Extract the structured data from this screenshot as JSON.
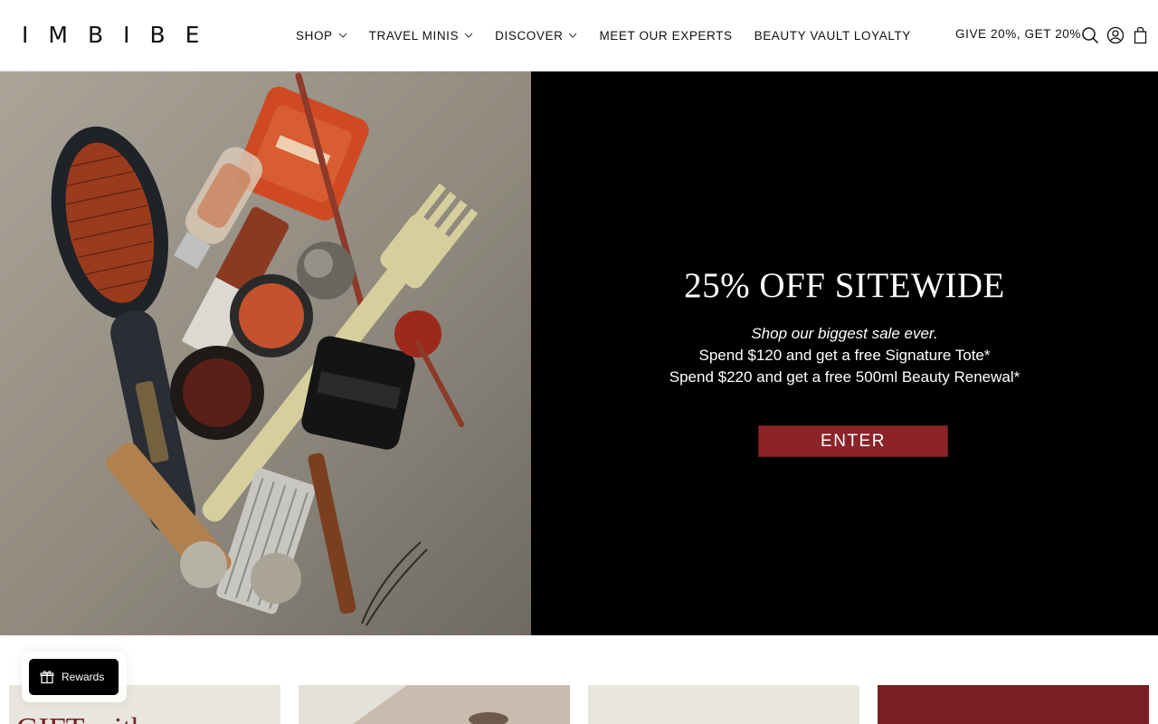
{
  "brand": {
    "logo_text": "IMBIBE"
  },
  "nav": {
    "items": [
      {
        "label": "SHOP",
        "has_dropdown": true
      },
      {
        "label": "TRAVEL MINIS",
        "has_dropdown": true
      },
      {
        "label": "DISCOVER",
        "has_dropdown": true
      },
      {
        "label": "MEET OUR EXPERTS",
        "has_dropdown": false
      },
      {
        "label": "BEAUTY VAULT LOYALTY",
        "has_dropdown": false
      }
    ],
    "give_label": "GIVE 20%, GET 20%",
    "icons": [
      "search-icon",
      "account-icon",
      "cart-icon"
    ]
  },
  "hero": {
    "title": "25% OFF SITEWIDE",
    "subtitle": "Shop our biggest sale ever.",
    "line1": "Spend $120 and get a free Signature Tote*",
    "line2": "Spend $220 and get a free 500ml Beauty Renewal*",
    "cta_label": "ENTER",
    "cta_color": "#8b2328",
    "panel_color": "#000000"
  },
  "cards": [
    {
      "text": "GIFT with"
    },
    {
      "text": ""
    },
    {
      "text": ""
    },
    {
      "text": ""
    }
  ],
  "rewards": {
    "label": "Rewards",
    "icon": "gift-icon"
  }
}
